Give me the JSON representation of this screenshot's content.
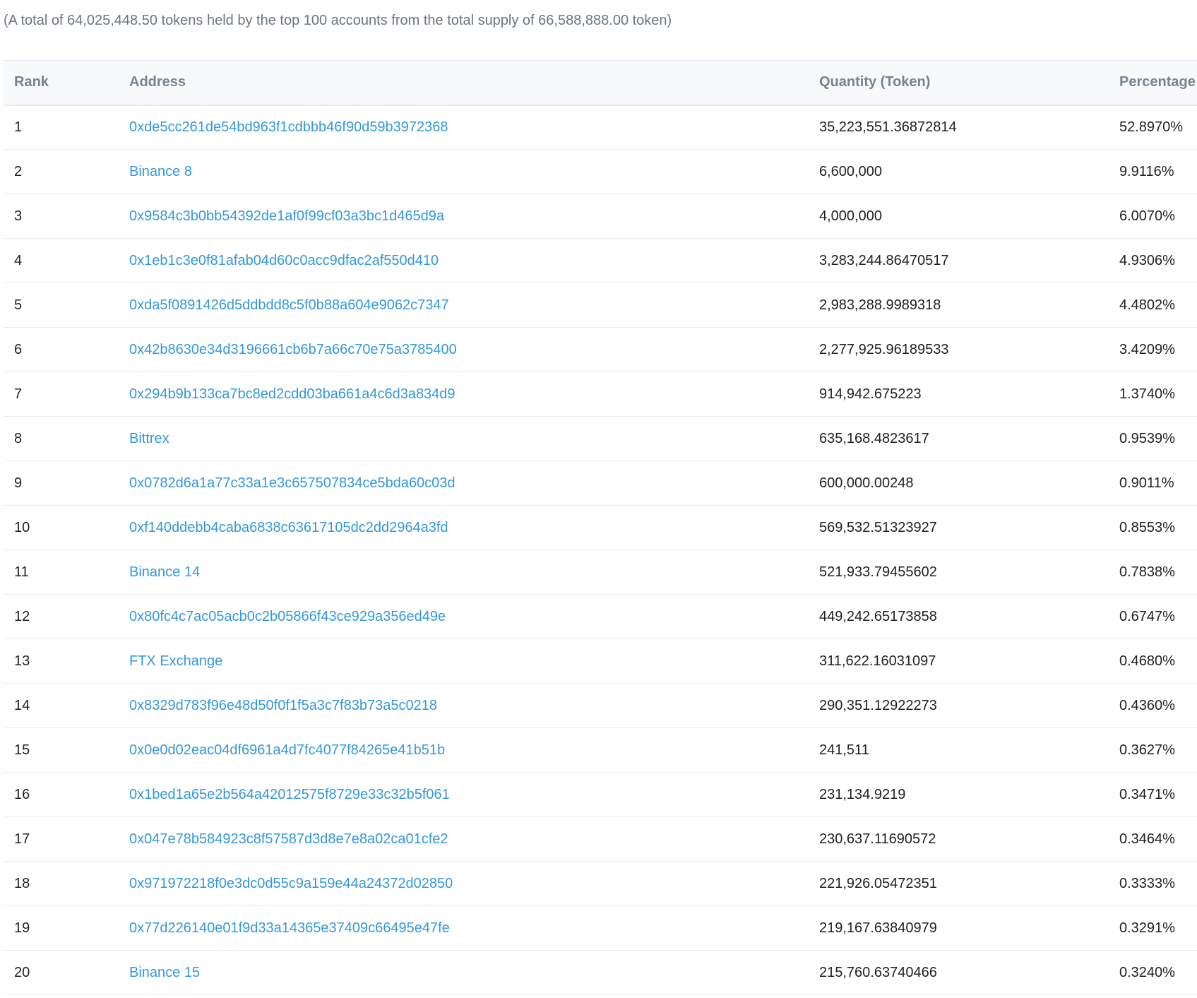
{
  "summary": "(A total of 64,025,448.50 tokens held by the top 100 accounts from the total supply of 66,588,888.00 token)",
  "table": {
    "headers": {
      "rank": "Rank",
      "address": "Address",
      "quantity": "Quantity (Token)",
      "percentage": "Percentage"
    },
    "rows": [
      {
        "rank": "1",
        "address": "0xde5cc261de54bd963f1cdbbb46f90d59b3972368",
        "quantity": "35,223,551.36872814",
        "percentage": "52.8970%"
      },
      {
        "rank": "2",
        "address": "Binance 8",
        "quantity": "6,600,000",
        "percentage": "9.9116%"
      },
      {
        "rank": "3",
        "address": "0x9584c3b0bb54392de1af0f99cf03a3bc1d465d9a",
        "quantity": "4,000,000",
        "percentage": "6.0070%"
      },
      {
        "rank": "4",
        "address": "0x1eb1c3e0f81afab04d60c0acc9dfac2af550d410",
        "quantity": "3,283,244.86470517",
        "percentage": "4.9306%"
      },
      {
        "rank": "5",
        "address": "0xda5f0891426d5ddbdd8c5f0b88a604e9062c7347",
        "quantity": "2,983,288.9989318",
        "percentage": "4.4802%"
      },
      {
        "rank": "6",
        "address": "0x42b8630e34d3196661cb6b7a66c70e75a3785400",
        "quantity": "2,277,925.96189533",
        "percentage": "3.4209%"
      },
      {
        "rank": "7",
        "address": "0x294b9b133ca7bc8ed2cdd03ba661a4c6d3a834d9",
        "quantity": "914,942.675223",
        "percentage": "1.3740%"
      },
      {
        "rank": "8",
        "address": "Bittrex",
        "quantity": "635,168.4823617",
        "percentage": "0.9539%"
      },
      {
        "rank": "9",
        "address": "0x0782d6a1a77c33a1e3c657507834ce5bda60c03d",
        "quantity": "600,000.00248",
        "percentage": "0.9011%"
      },
      {
        "rank": "10",
        "address": "0xf140ddebb4caba6838c63617105dc2dd2964a3fd",
        "quantity": "569,532.51323927",
        "percentage": "0.8553%"
      },
      {
        "rank": "11",
        "address": "Binance 14",
        "quantity": "521,933.79455602",
        "percentage": "0.7838%"
      },
      {
        "rank": "12",
        "address": "0x80fc4c7ac05acb0c2b05866f43ce929a356ed49e",
        "quantity": "449,242.65173858",
        "percentage": "0.6747%"
      },
      {
        "rank": "13",
        "address": "FTX Exchange",
        "quantity": "311,622.16031097",
        "percentage": "0.4680%"
      },
      {
        "rank": "14",
        "address": "0x8329d783f96e48d50f0f1f5a3c7f83b73a5c0218",
        "quantity": "290,351.12922273",
        "percentage": "0.4360%"
      },
      {
        "rank": "15",
        "address": "0x0e0d02eac04df6961a4d7fc4077f84265e41b51b",
        "quantity": "241,511",
        "percentage": "0.3627%"
      },
      {
        "rank": "16",
        "address": "0x1bed1a65e2b564a42012575f8729e33c32b5f061",
        "quantity": "231,134.9219",
        "percentage": "0.3471%"
      },
      {
        "rank": "17",
        "address": "0x047e78b584923c8f57587d3d8e7e8a02ca01cfe2",
        "quantity": "230,637.11690572",
        "percentage": "0.3464%"
      },
      {
        "rank": "18",
        "address": "0x971972218f0e3dc0d55c9a159e44a24372d02850",
        "quantity": "221,926.05472351",
        "percentage": "0.3333%"
      },
      {
        "rank": "19",
        "address": "0x77d226140e01f9d33a14365e37409c66495e47fe",
        "quantity": "219,167.63840979",
        "percentage": "0.3291%"
      },
      {
        "rank": "20",
        "address": "Binance 15",
        "quantity": "215,760.63740466",
        "percentage": "0.3240%"
      }
    ]
  },
  "colors": {
    "link": "#3498db",
    "header_text": "#77838f",
    "header_bg": "#f8f9fa",
    "border": "#e7eaf3",
    "summary_text": "#6c757e"
  }
}
